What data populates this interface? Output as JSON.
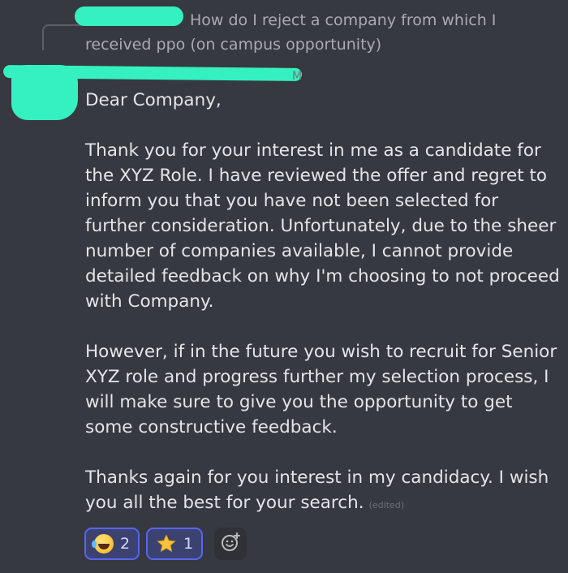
{
  "reply": {
    "text": "How do I reject a company from which I received ppo (on campus opportunity)"
  },
  "timestamp": "M",
  "message": {
    "greeting": "Dear Company,",
    "paragraph_1": "Thank you for your interest in me as a candidate for the XYZ Role. I have reviewed the offer and regret to inform you that you have not been selected for further consideration. Unfortunately, due to the sheer number of companies available, I cannot provide detailed feedback on why I'm choosing to not proceed with Company.",
    "paragraph_2": "However, if in the future you wish to recruit for Senior XYZ role and progress further my selection process, I will make sure to give you the opportunity to get some constructive feedback.",
    "paragraph_3": "Thanks again for you interest in my candidacy. I wish you all the best for your search.",
    "edited_label": "(edited)"
  },
  "reactions": [
    {
      "icon": "laughing-face-icon",
      "count": "2"
    },
    {
      "icon": "star-icon",
      "count": "1"
    }
  ],
  "add_reaction_icon": "add-reaction-icon",
  "colors": {
    "background": "#36393f",
    "accent": "#5865f2",
    "redaction": "#35f0c0"
  }
}
